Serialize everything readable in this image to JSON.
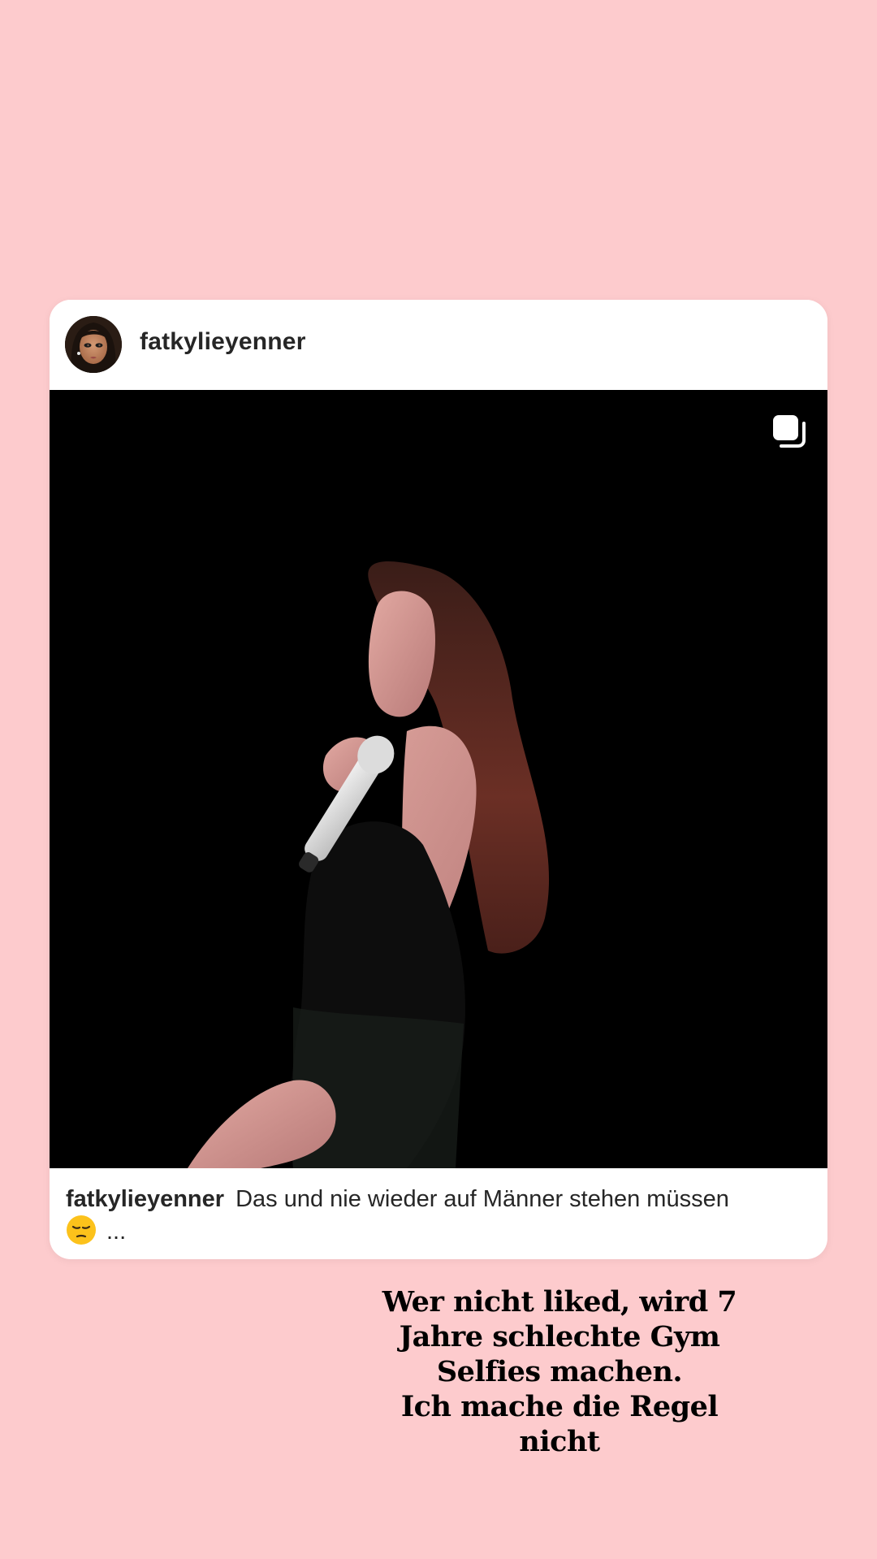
{
  "post": {
    "username": "fatkylieyenner",
    "avatar_icon": "bratz-doll-avatar",
    "media_icon": "multiple-posts-icon",
    "media_description_icon": "performer-with-microphone-photo",
    "caption": {
      "username": "fatkylieyenner",
      "text": "Das und nie wieder auf Männer stehen müssen",
      "emoji": "pensive-face-emoji",
      "more": "..."
    }
  },
  "story": {
    "text": "Wer nicht liked, wird 7\nJahre schlechte Gym\nSelfies machen.\nIch mache die Regel\nnicht"
  },
  "colors": {
    "background": "#fdcbcd",
    "card": "#ffffff",
    "media_background": "#000000",
    "text": "#262626"
  }
}
